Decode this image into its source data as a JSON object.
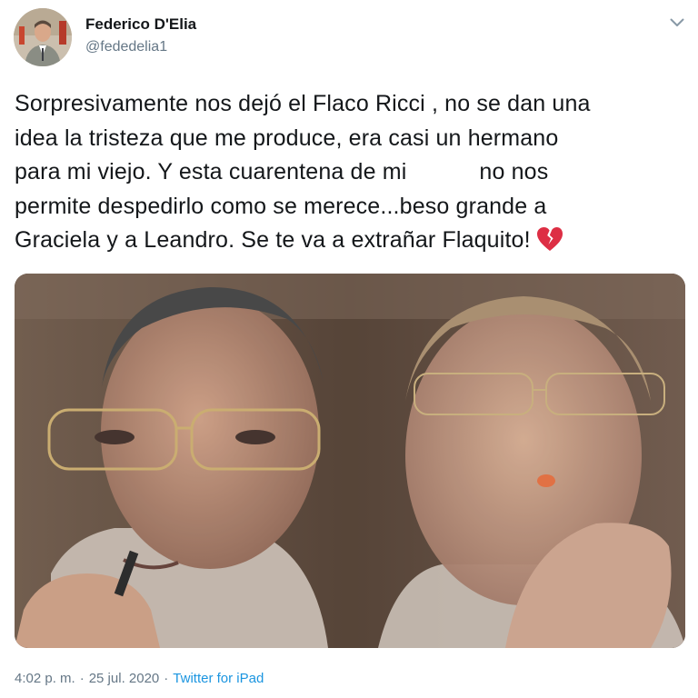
{
  "author": {
    "display_name": "Federico D'Elia",
    "handle": "@fededelia1",
    "avatar_icon": "profile-photo"
  },
  "menu": {
    "icon": "chevron-down-icon"
  },
  "tweet": {
    "lines": [
      "Sorpresivamente nos dejó el Flaco Ricci , no se dan una",
      "idea la tristeza que me produce, era casi un hermano",
      "para mi viejo. Y esta cuarentena de mi",
      "no nos",
      "permite despedirlo como se merece...beso grande a",
      "Graciela y a Leandro. Se te va a extrañar Flaquito!"
    ],
    "emoji": "broken-heart-icon"
  },
  "media": {
    "type": "photo",
    "description_icon": "two-men-glasses-photo"
  },
  "footer": {
    "time": "4:02 p. m.",
    "separator": "·",
    "date": "25 jul. 2020",
    "source": "Twitter for iPad"
  },
  "colors": {
    "text": "#14171a",
    "secondary": "#657786",
    "link": "#1b95e0",
    "emoji": "#dd2e44"
  }
}
